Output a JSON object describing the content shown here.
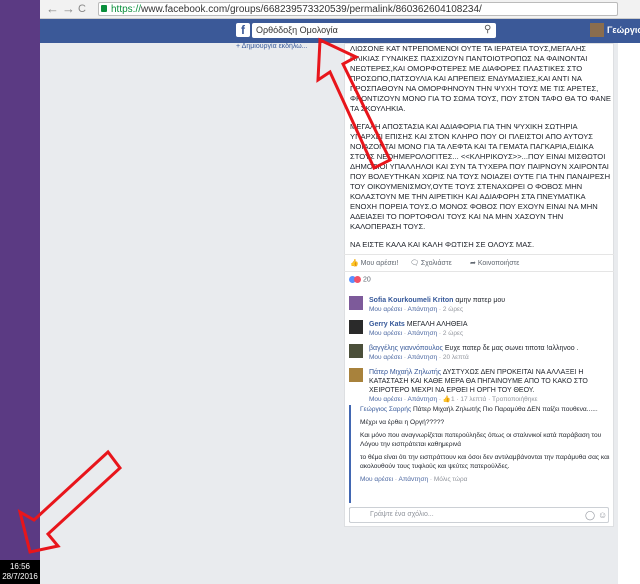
{
  "taskbar": {
    "time": "16:56",
    "date": "28/7/2016"
  },
  "browser": {
    "back": "←",
    "forward": "→",
    "reload": "C",
    "url_protocol": "https://",
    "url_rest": "www.facebook.com/groups/668239573320539/permalink/860362604108234/"
  },
  "facebook": {
    "logo": "f",
    "search_value": "Ορθόδοξη Ομολογία",
    "username": "Γεώργιος",
    "left_link": "Δημιουργία εκδήλω..."
  },
  "post": {
    "paragraphs": [
      "ΛΙΩΣΟΝΕ ΚΑΤ ΝΤΡΕΠΟΜΕΝΟΙ ΟΥΤΕ ΤΑ ΙΕΡΑΤΕΙΑ ΤΟΥΣ,ΜΕΓΑΛΗΣ ΗΛΙΚΙΑΣ ΓΥΝΑΙΚΕΣ ΠΑΣΧΙΖΟΥΝ ΠΑΝΤΟΙΟΤΡΟΠΩΣ ΝΑ ΦΑΙΝΟΝΤΑΙ ΝΕΩΤΕΡΕΣ,ΚΑΙ ΟΜΟΡΦΟΤΕΡΕΣ ΜΕ ΔΙΑΦΟΡΕΣ ΠΛΑΣΤΙΚΕΣ ΣΤΟ ΠΡΟΣΩΠΟ,ΠΑΤΣΟΥΛΙΑ ΚΑΙ ΑΠΡΕΠΕΙΣ ΕΝΔΥΜΑΣΙΕΣ,ΚΑΙ ΑΝΤΙ ΝΑ ΠΡΟΣΠΑΘΟΥΝ ΝΑ ΟΜΟΡΦΗΝΟΥΝ ΤΗΝ ΨΥΧΗ ΤΟΥΣ ΜΕ ΤΙΣ ΑΡΕΤΕΣ, ΦΡΟΝΤΙΖΟΥΝ ΜΟΝΟ ΓΙΑ ΤΟ ΣΩΜΑ ΤΟΥΣ, ΠΟΥ ΣΤΟΝ ΤΑΦΟ ΘΑ ΤΟ ΦΑΝΕ ΤΑ ΣΚΟΥΛΗΚΙΑ.",
      "ΜΕΓΑΛΗ ΑΠΟΣΤΑΣΙΑ ΚΑΙ ΑΔΙΑΦΟΡΙΑ ΓΙΑ ΤΗΝ ΨΥΧΙΚΗ ΣΩΤΗΡΙΑ ΥΠΑΡΧΕΙ ΕΠΙΣΗΣ ΚΑΙ ΣΤΟΝ ΚΛΗΡΟ ΠΟΥ ΟΙ ΠΛΕΙΣΤΟΙ ΑΠΟ ΑΥΤΟΥΣ ΝΟΙΑΖΟΝΤΑΙ ΜΟΝΟ ΓΙΑ ΤΑ ΛΕΦΤΑ ΚΑΙ ΤΑ ΓΕΜΑΤΑ ΠΑΓΚΑΡΙΑ,ΕΙΔΙΚΑ ΣΤΟΥΣ ΝΕΟΗΜΕΡΟΛΟΓΙΤΕΣ... <<ΚΛΗΡΙΚΟΥΣ>>...ΠΟΥ ΕΙΝΑΙ ΜΙΣΘΩΤΟΙ ΔΗΜΟΣΙΟΙ ΥΠΑΛΛΗΛΟΙ ΚΑΙ ΣΥΝ ΤΑ ΤΥΧΕΡΑ ΠΟΥ ΠΑΙΡΝΟΥΝ ΧΑΙΡΟΝΤΑΙ ΠΟΥ ΒΟΛΕΥΤΗΚΑΝ ΧΩΡΙΣ ΝΑ ΤΟΥΣ ΝΟΙΑΖΕΙ ΟΥΤΕ ΓΙΑ ΤΗΝ ΠΑΝΑΙΡΕΣΗ ΤΟΥ ΟΙΚΟΥΜΕΝΙΣΜΟΥ,ΟΥΤΕ ΤΟΥΣ ΣΤΕΝΑΧΩΡΕΙ Ο ΦΟΒΟΣ ΜΗΝ ΚΟΛΑΣΤΟΥΝ ΜΕ ΤΗΝ ΑΙΡΕΤΙΚΗ ΚΑΙ ΑΔΙΑΦΟΡΗ ΣΤΑ ΠΝΕΥΜΑΤΙΚΑ ΕΝΟΧΗ ΠΟΡΕΙΑ ΤΟΥΣ.Ο ΜΟΝΟΣ ΦΟΒΟΣ ΠΟΥ ΕΧΟΥΝ ΕΙΝΑΙ ΝΑ ΜΗΝ ΑΔΕΙΑΣΕΙ ΤΟ ΠΟΡΤΟΦΟΛΙ ΤΟΥΣ ΚΑΙ ΝΑ ΜΗΝ ΧΑΣΟΥΝ ΤΗΝ ΚΑΛΟΠΕΡΑΣΗ ΤΟΥΣ.",
      "ΝΑ ΕΙΣΤΕ ΚΑΛΑ ΚΑΙ ΚΑΛΗ ΦΩΤΙΣΗ ΣΕ ΟΛΟΥΣ ΜΑΣ."
    ],
    "actions": {
      "like": "Μου αρέσει!",
      "comment": "Σχολιάστε",
      "share": "Κοινοποιήστε"
    },
    "reaction_count": "20",
    "comments": [
      {
        "name": "Sofia Kourkoumeli Kriton",
        "text": "αμην πατερ μου",
        "like": "Μου αρέσει",
        "reply": "Απάντηση",
        "time": "2 ώρες"
      },
      {
        "name": "Gerry Kats",
        "text": "ΜΕΓΑΛΗ ΑΛΗΘΕΙΑ",
        "like": "Μου αρέσει",
        "reply": "Απάντηση",
        "time": "2 ώρες"
      },
      {
        "name": "βαγγέλης γιαννόπουλος",
        "text": "Ευχε πατερ δε μας σωνει τιποτα !αλληνοο .",
        "like": "Μου αρέσει",
        "reply": "Απάντηση",
        "time": "20 λεπτά"
      },
      {
        "name": "Πάτερ Μιχαήλ Ζηλωτής",
        "text": "ΔΥΣΤΥΧΩΣ ΔΕΝ ΠΡΟΚΕΙΤΑΙ ΝΑ ΑΛΛΑΞΕΙ Η ΚΑΤΑΣΤΑΣΗ ΚΑΙ ΚΑΘΕ ΜΕΡΑ ΘΑ ΠΗΓΑΙΝΟΥΜΕ ΑΠΟ ΤΟ ΚΑΚΟ ΣΤΟ ΧΕΙΡΟΤΕΡΟ ΜΕΧΡΙ ΝΑ ΕΡΘΕΙ Η ΟΡΓΗ ΤΟΥ ΘΕΟΥ.",
        "like": "Μου αρέσει",
        "reply": "Απάντηση",
        "likes": "1",
        "time": "17 λεπτά",
        "edit": "Τροποποιήθηκε"
      }
    ],
    "reply": {
      "name": "Γεώργιος Σαρρής",
      "lines": [
        "Πάτερ Μιχαήλ Ζηλωτής Πιο Παραμύθα ΔΕΝ παίζει πουθενα......",
        "Μέχρι να έρθει η Οργή?????",
        "Και μόνο που αναγνωρίζεται πατερούληδες όπως οι σταλινικοί κατά παράβαση του Λόγου την εισπράτεται καθημερινά",
        "το θέμα είναι ότι την εισπράττουν και όσοι δεν αντιλαμβάνονται την παράμυθα σας και ακολουθούν τους τυφλούς και ψεύτες πατερούλδες."
      ],
      "like": "Μου αρέσει",
      "reply_label": "Απάντηση",
      "time": "Μόλις τώρα"
    },
    "write_placeholder": "Γράψτε ένα σχόλιο..."
  },
  "colors": {
    "fb_blue": "#3b5998",
    "annotation_red": "#e8151b",
    "desktop_purple": "#5b3a83"
  }
}
